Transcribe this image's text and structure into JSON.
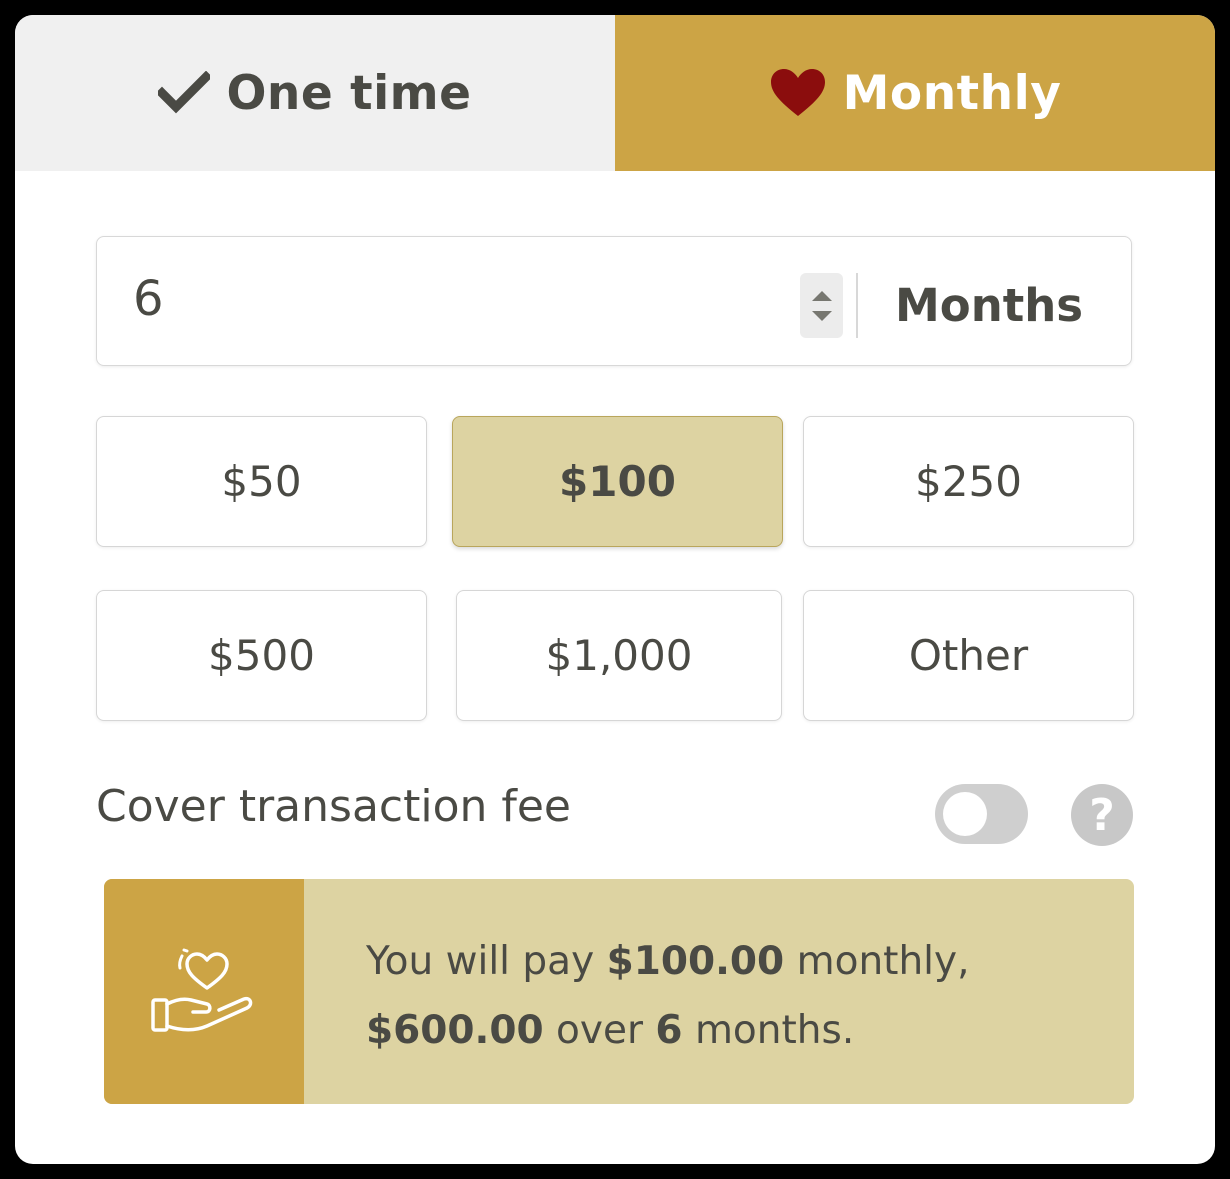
{
  "tabs": {
    "one_time": {
      "label": "One time",
      "icon": "check-icon"
    },
    "monthly": {
      "label": "Monthly",
      "icon": "heart-icon",
      "active": true
    }
  },
  "months": {
    "value": "6",
    "unit": "Months"
  },
  "amounts": [
    {
      "label": "$50",
      "selected": false
    },
    {
      "label": "$100",
      "selected": true
    },
    {
      "label": "$250",
      "selected": false
    },
    {
      "label": "$500",
      "selected": false
    },
    {
      "label": "$1,000",
      "selected": false
    },
    {
      "label": "Other",
      "selected": false
    }
  ],
  "fee": {
    "label": "Cover transaction fee",
    "enabled": false,
    "help_icon": "question-icon"
  },
  "summary": {
    "icon": "hand-heart-icon",
    "prefix": "You will pay ",
    "monthly_amount": "$100.00",
    "monthly_suffix": " monthly,",
    "total": "$600.00",
    "over": " over ",
    "months": "6",
    "months_suffix": " months."
  },
  "colors": {
    "gold": "#cca445",
    "gold_light": "#ddd3a2",
    "text": "#4a4a44",
    "heart": "#8b0d0d"
  }
}
